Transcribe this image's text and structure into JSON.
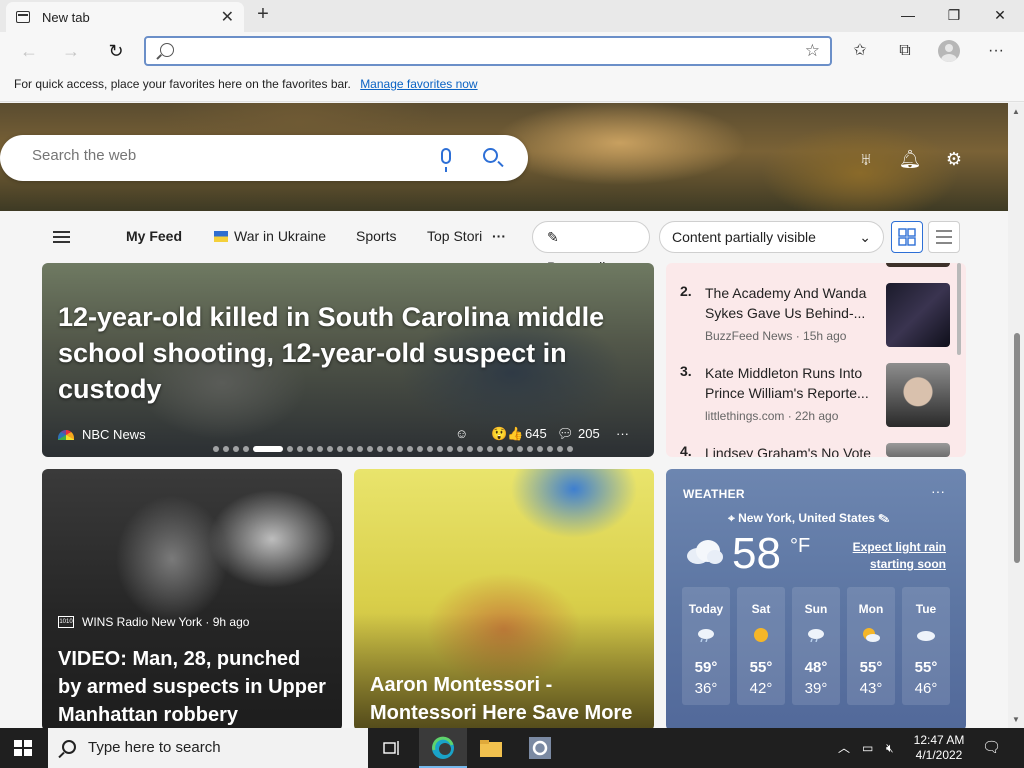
{
  "browser": {
    "tab_title": "New tab",
    "tab_close": "✕",
    "new_tab": "+",
    "window_controls": {
      "minimize": "—",
      "maximize": "❐",
      "close": "✕"
    },
    "address_value": "",
    "favorites_message": "For quick access, place your favorites here on the favorites bar.",
    "favorites_link": "Manage favorites now"
  },
  "newtab": {
    "search_placeholder": "Search the web",
    "feed_nav": {
      "items": [
        "My Feed",
        "War in Ukraine",
        "Sports",
        "Top Stori"
      ],
      "more": "···",
      "personalize": "Personalize",
      "content_visibility": "Content partially visible"
    },
    "hero_story": {
      "headline": "12-year-old killed in South Carolina middle school shooting, 12-year-old suspect in custody",
      "source": "NBC News",
      "reactions": "645",
      "comments": "205"
    },
    "trending": [
      {
        "num": "2.",
        "title": "The Academy And Wanda Sykes Gave Us Behind-...",
        "source": "BuzzFeed News · 15h ago"
      },
      {
        "num": "3.",
        "title": "Kate Middleton Runs Into Prince William's Reporte...",
        "source": "littlethings.com · 22h ago"
      },
      {
        "num": "4.",
        "title": "Lindsey Graham's No Vote",
        "source": ""
      }
    ],
    "card2": {
      "source": "WINS Radio New York · 9h ago",
      "title": "VIDEO: Man, 28, punched by armed suspects in Upper Manhattan robbery"
    },
    "card3": {
      "title": "Aaron Montessori - Montessori Here Save More"
    },
    "weather": {
      "label": "WEATHER",
      "location": "New York, United States",
      "temp": "58",
      "unit": "°F",
      "alert": "Expect light rain starting soon",
      "days": [
        {
          "day": "Today",
          "hi": "59°",
          "lo": "36°",
          "icon": "cloud-rain-icon"
        },
        {
          "day": "Sat",
          "hi": "55°",
          "lo": "42°",
          "icon": "sun-icon"
        },
        {
          "day": "Sun",
          "hi": "48°",
          "lo": "39°",
          "icon": "cloud-rain-icon"
        },
        {
          "day": "Mon",
          "hi": "55°",
          "lo": "43°",
          "icon": "partly-sunny-icon"
        },
        {
          "day": "Tue",
          "hi": "55°",
          "lo": "46°",
          "icon": "cloud-icon"
        }
      ]
    }
  },
  "taskbar": {
    "search_placeholder": "Type here to search",
    "time": "12:47 AM",
    "date": "4/1/2022"
  }
}
